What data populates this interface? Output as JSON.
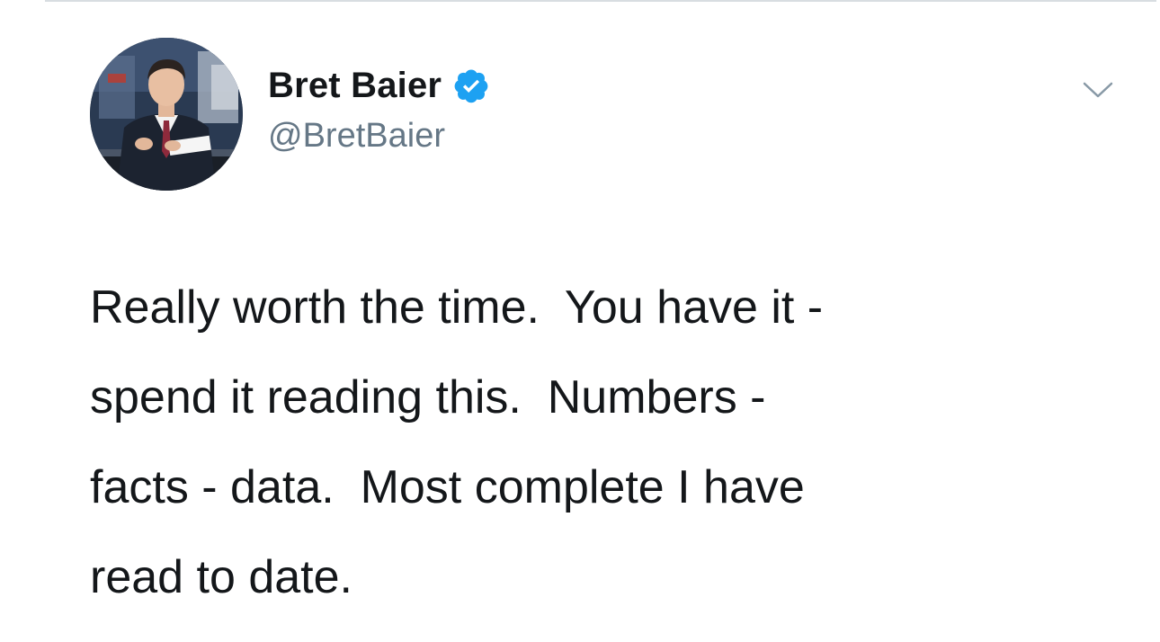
{
  "tweet": {
    "author": {
      "display_name": "Bret Baier",
      "handle": "@BretBaier",
      "verified": true,
      "avatar": "profile-photo"
    },
    "menu_icon": "chevron-down-icon",
    "text_lines": [
      "Really worth the time.  You have it -",
      "spend it reading this.  Numbers -",
      "facts - data.  Most complete I have",
      "read to date."
    ]
  },
  "colors": {
    "verified_blue": "#1da1f2",
    "handle_gray": "#657786",
    "text_dark": "#14171a",
    "divider": "#d8dde1"
  }
}
